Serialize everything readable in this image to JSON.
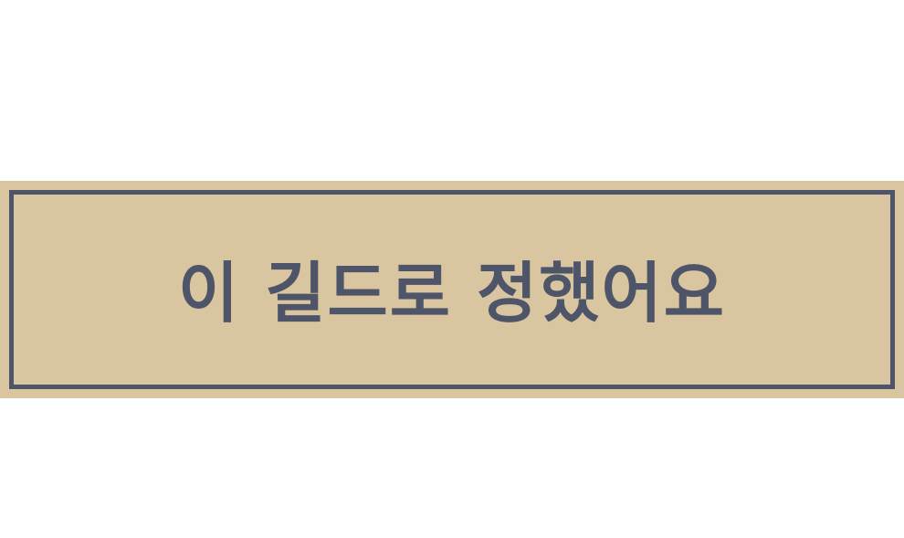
{
  "banner": {
    "text": "이 길드로 정했어요",
    "background_color": "#d9c6a0",
    "border_color": "#4f5568",
    "text_color": "#4f5568"
  }
}
